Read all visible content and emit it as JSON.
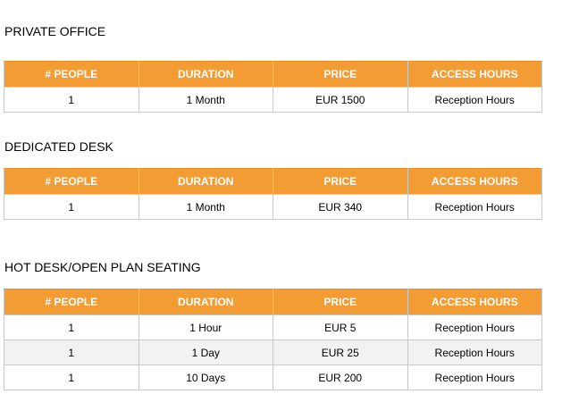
{
  "headers": [
    "# PEOPLE",
    "DURATION",
    "PRICE",
    "ACCESS HOURS"
  ],
  "sections": [
    {
      "title": "PRIVATE OFFICE",
      "rows": [
        [
          "1",
          "1 Month",
          "EUR 1500",
          "Reception Hours"
        ]
      ]
    },
    {
      "title": "DEDICATED DESK",
      "rows": [
        [
          "1",
          "1 Month",
          "EUR 340",
          "Reception Hours"
        ]
      ]
    },
    {
      "title": "HOT DESK/OPEN PLAN SEATING",
      "rows": [
        [
          "1",
          "1 Hour",
          "EUR 5",
          "Reception Hours"
        ],
        [
          "1",
          "1 Day",
          "EUR 25",
          "Reception Hours"
        ],
        [
          "1",
          "10 Days",
          "EUR 200",
          "Reception Hours"
        ]
      ]
    }
  ],
  "colors": {
    "header_bg": "#f39c34",
    "header_text": "#ffffff",
    "border": "#c9c9c9",
    "alt_row_bg": "#f2f2f2"
  }
}
